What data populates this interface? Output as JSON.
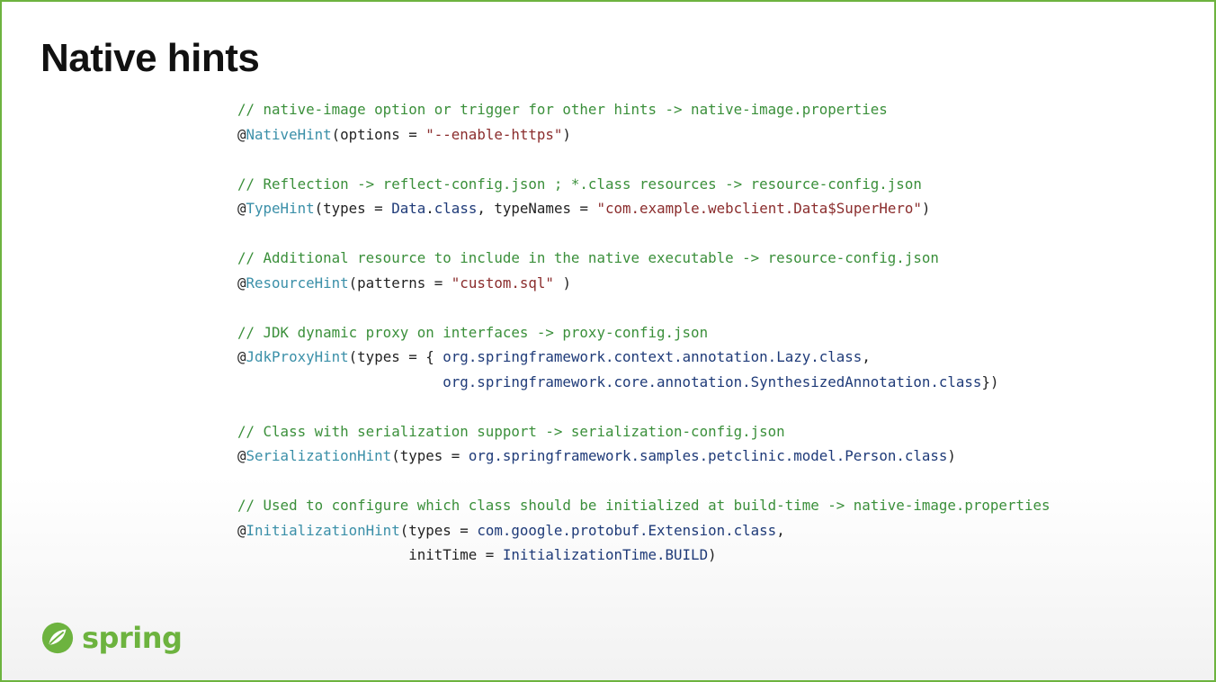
{
  "slide": {
    "title": "Native hints",
    "logo_text": "spring",
    "accent_color": "#6db33f"
  },
  "code_lines": [
    [
      {
        "t": "// native-image option or trigger for other hints -> native-image.properties",
        "c": "cm"
      }
    ],
    [
      {
        "t": "@",
        "c": ""
      },
      {
        "t": "NativeHint",
        "c": "an"
      },
      {
        "t": "(options = ",
        "c": ""
      },
      {
        "t": "\"--enable-https\"",
        "c": "st"
      },
      {
        "t": ")",
        "c": ""
      }
    ],
    [],
    [
      {
        "t": "// Reflection -> reflect-config.json ; *.class resources -> resource-config.json",
        "c": "cm"
      }
    ],
    [
      {
        "t": "@",
        "c": ""
      },
      {
        "t": "TypeHint",
        "c": "an"
      },
      {
        "t": "(types = ",
        "c": ""
      },
      {
        "t": "Data",
        "c": "ty"
      },
      {
        "t": ".",
        "c": ""
      },
      {
        "t": "class",
        "c": "ty"
      },
      {
        "t": ", typeNames = ",
        "c": ""
      },
      {
        "t": "\"com.example.webclient.Data$SuperHero\"",
        "c": "st"
      },
      {
        "t": ")",
        "c": ""
      }
    ],
    [],
    [
      {
        "t": "// Additional resource to include in the native executable -> resource-config.json",
        "c": "cm"
      }
    ],
    [
      {
        "t": "@",
        "c": ""
      },
      {
        "t": "ResourceHint",
        "c": "an"
      },
      {
        "t": "(patterns = ",
        "c": ""
      },
      {
        "t": "\"custom.sql\"",
        "c": "st"
      },
      {
        "t": " )",
        "c": ""
      }
    ],
    [],
    [
      {
        "t": "// JDK dynamic proxy on interfaces -> proxy-config.json",
        "c": "cm"
      }
    ],
    [
      {
        "t": "@",
        "c": ""
      },
      {
        "t": "JdkProxyHint",
        "c": "an"
      },
      {
        "t": "(types = { ",
        "c": ""
      },
      {
        "t": "org.springframework.context.annotation.Lazy.class",
        "c": "ty"
      },
      {
        "t": ",",
        "c": ""
      }
    ],
    [
      {
        "t": "                        ",
        "c": ""
      },
      {
        "t": "org.springframework.core.annotation.SynthesizedAnnotation.class",
        "c": "ty"
      },
      {
        "t": "})",
        "c": ""
      }
    ],
    [],
    [
      {
        "t": "// Class with serialization support -> serialization-config.json",
        "c": "cm"
      }
    ],
    [
      {
        "t": "@",
        "c": ""
      },
      {
        "t": "SerializationHint",
        "c": "an"
      },
      {
        "t": "(types = ",
        "c": ""
      },
      {
        "t": "org.springframework.samples.petclinic.model.Person.class",
        "c": "ty"
      },
      {
        "t": ")",
        "c": ""
      }
    ],
    [],
    [
      {
        "t": "// Used to configure which class should be initialized at build-time -> native-image.properties",
        "c": "cm"
      }
    ],
    [
      {
        "t": "@",
        "c": ""
      },
      {
        "t": "InitializationHint",
        "c": "an"
      },
      {
        "t": "(types = ",
        "c": ""
      },
      {
        "t": "com.google.protobuf.Extension.class",
        "c": "ty"
      },
      {
        "t": ",",
        "c": ""
      }
    ],
    [
      {
        "t": "                    initTime = ",
        "c": ""
      },
      {
        "t": "InitializationTime.BUILD",
        "c": "ty"
      },
      {
        "t": ")",
        "c": ""
      }
    ]
  ]
}
